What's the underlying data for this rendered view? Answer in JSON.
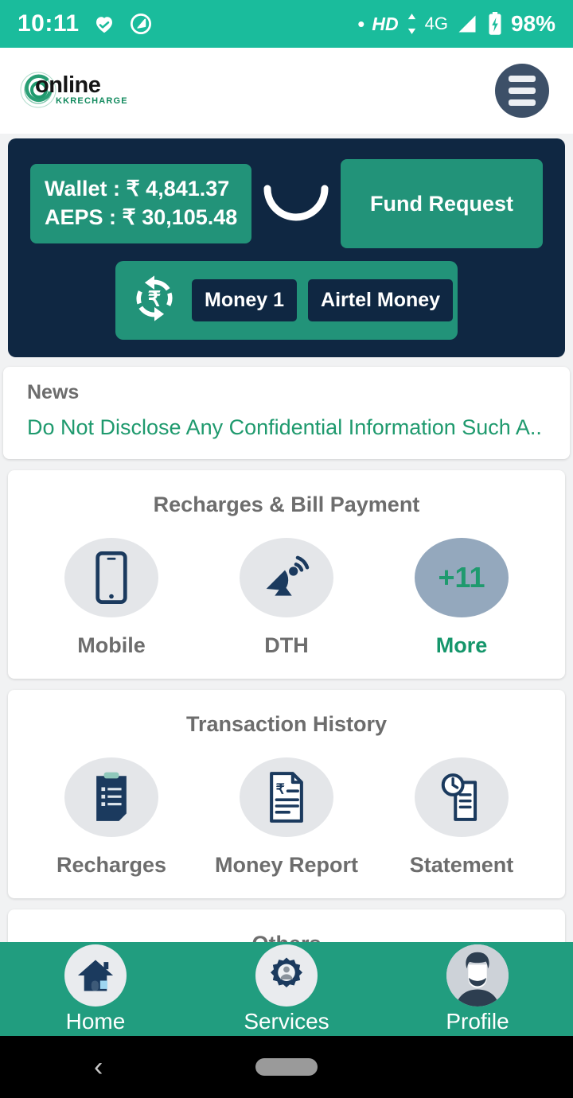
{
  "statusbar": {
    "time": "10:11",
    "icons_left": [
      "heart-check-icon",
      "dnd-icon"
    ],
    "dot": "•",
    "hd": "HD",
    "network": "4G",
    "battery_pct": "98%",
    "background_color": "#1abc9c"
  },
  "header": {
    "logo_text": "online",
    "logo_subtext": "KKRECHARGE",
    "menu_label": "menu"
  },
  "balance": {
    "wallet_line": "Wallet : ₹ 4,841.37",
    "aeps_line": "AEPS : ₹ 30,105.48",
    "fund_request_label": "Fund Request",
    "money_buttons": [
      "Money 1",
      "Airtel Money"
    ],
    "card_color": "#0f2742",
    "accent_color": "#229379"
  },
  "news": {
    "title": "News",
    "text": "Do Not Disclose Any Confidential Information Such A..",
    "text_color": "#1f9a6e"
  },
  "sections": [
    {
      "title": "Recharges & Bill Payment",
      "tiles": [
        {
          "label": "Mobile",
          "icon": "mobile-phone-icon",
          "accent": false
        },
        {
          "label": "DTH",
          "icon": "satellite-dish-icon",
          "accent": false
        },
        {
          "label": "More",
          "icon": "more-count",
          "badge": "+11",
          "accent": true
        }
      ]
    },
    {
      "title": "Transaction History",
      "tiles": [
        {
          "label": "Recharges",
          "icon": "clipboard-list-icon",
          "accent": false
        },
        {
          "label": "Money Report",
          "icon": "rupee-document-icon",
          "accent": false
        },
        {
          "label": "Statement",
          "icon": "clock-document-icon",
          "accent": false
        }
      ]
    },
    {
      "title": "Others",
      "tiles": []
    }
  ],
  "bottomnav": {
    "background_color": "#219D7F",
    "items": [
      {
        "label": "Home",
        "icon": "house-icon"
      },
      {
        "label": "Services",
        "icon": "gear-person-icon"
      },
      {
        "label": "Profile",
        "icon": "avatar-icon"
      }
    ]
  },
  "androidnav": {
    "back": "‹"
  }
}
